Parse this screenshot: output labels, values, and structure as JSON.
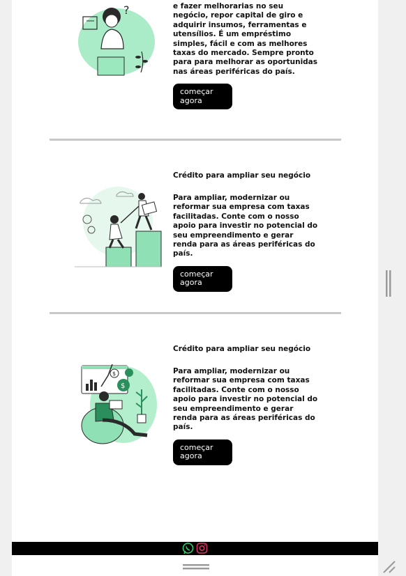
{
  "sections": [
    {
      "description": "e fazer melhorarias no seu negócio, repor capital de giro e adquirir insumos, ferramentas e utensílios. É um empréstimo simples, fácil e com as melhores taxas do mercado. Sempre pronto para para melhorar as oportunidas nas áreas periféricas do país.",
      "button_label": "começar agora"
    },
    {
      "title": "Crédito para ampliar seu negócio",
      "description": "Para ampliar, modernizar ou reformar sua empresa com taxas facilitadas. Conte com o nosso apoio para investir no potencial do seu empreendimento e gerar renda para as áreas periféricas do país.",
      "button_label": "começar agora"
    },
    {
      "title": "Crédito para ampliar seu negócio",
      "description": "Para ampliar, modernizar ou reformar sua empresa com taxas facilitadas. Conte com o nosso apoio para investir no potencial do seu empreendimento e gerar renda para as áreas periféricas do país.",
      "button_label": "começar agora"
    }
  ],
  "footer": {
    "icons": [
      "whatsapp-icon",
      "instagram-icon"
    ],
    "whatsapp_color": "#25d366",
    "instagram_color": "#e1306c"
  },
  "colors": {
    "accent_green": "#8fe0b4",
    "button_bg": "#000000"
  }
}
